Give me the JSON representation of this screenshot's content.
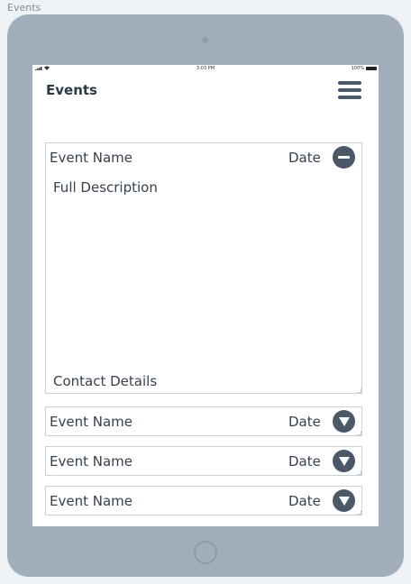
{
  "document": {
    "label": "Events"
  },
  "status_bar": {
    "time": "3:03 PM",
    "battery_pct": "100%"
  },
  "header": {
    "title": "Events"
  },
  "events": [
    {
      "name": "Event Name",
      "date": "Date",
      "expanded": true,
      "description": "Full Description",
      "contact": "Contact Details",
      "toggle_icon": "minus-circle-icon"
    },
    {
      "name": "Event Name",
      "date": "Date",
      "expanded": false,
      "toggle_icon": "chevron-down-circle-icon"
    },
    {
      "name": "Event Name",
      "date": "Date",
      "expanded": false,
      "toggle_icon": "chevron-down-circle-icon"
    },
    {
      "name": "Event Name",
      "date": "Date",
      "expanded": false,
      "toggle_icon": "chevron-down-circle-icon"
    }
  ],
  "colors": {
    "device_frame": "#a0adba",
    "page_background": "#eff2f5",
    "accent_dark": "#4a5868",
    "border": "#c8d0d8",
    "text": "#35414e"
  }
}
